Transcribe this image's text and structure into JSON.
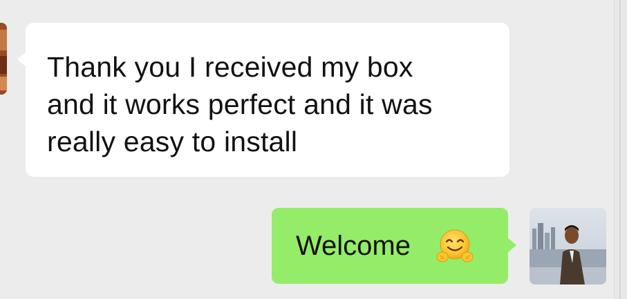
{
  "chat": {
    "messages": [
      {
        "direction": "incoming",
        "lines": [
          "Thank you I received my box",
          "and it works perfect and it was",
          "really easy to install"
        ]
      },
      {
        "direction": "outgoing",
        "text": "Welcome",
        "emoji": "hugging-face-icon"
      }
    ]
  },
  "colors": {
    "background": "#ececec",
    "incoming_bubble": "#ffffff",
    "outgoing_bubble": "#95ec69",
    "text": "#111111"
  }
}
